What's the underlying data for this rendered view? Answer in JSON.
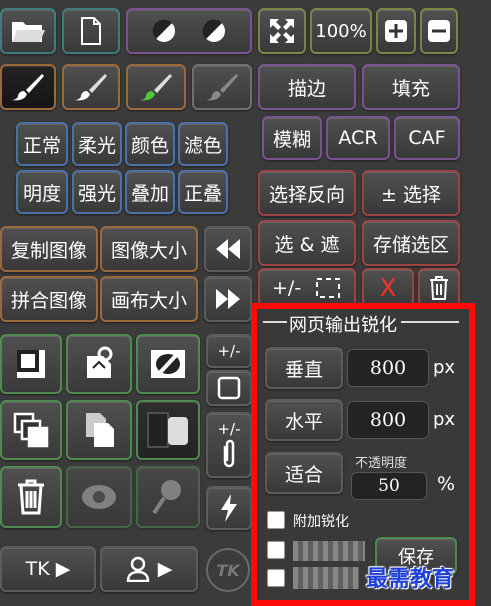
{
  "top": {
    "zoom_label": "100%"
  },
  "modes": {
    "row1": [
      "正常",
      "柔光",
      "颜色",
      "滤色"
    ],
    "row2": [
      "明度",
      "强光",
      "叠加",
      "正叠"
    ]
  },
  "image": {
    "duplicate": "复制图像",
    "image_size": "图像大小",
    "flatten": "拼合图像",
    "canvas_size": "画布大小"
  },
  "edit": {
    "stroke": "描边",
    "fill": "填充",
    "blur": "模糊",
    "acr": "ACR",
    "caf": "CAF",
    "invert_selection": "选择反向",
    "plus_minus_selection": "± 选择",
    "select_and_mask": "选 & 遮",
    "save_selection": "存储选区",
    "plus_minus": "+/-",
    "delete_x": "X"
  },
  "side": {
    "plus_minus_1": "+/-",
    "plus_minus_2": "+/-",
    "tk_logo": "TK"
  },
  "bottom": {
    "tk_label": "TK ▶",
    "person_label": "▶"
  },
  "sharpen": {
    "title": "网页输出锐化",
    "vertical_label": "垂直",
    "vertical_value": "800",
    "horizontal_label": "水平",
    "horizontal_value": "800",
    "px_unit": "px",
    "fit_label": "适合",
    "opacity_label": "不透明度",
    "opacity_value": "50",
    "percent_unit": "%",
    "extra_sharpen": "附加锐化",
    "save_label": "保存"
  },
  "watermark": "最需教育"
}
